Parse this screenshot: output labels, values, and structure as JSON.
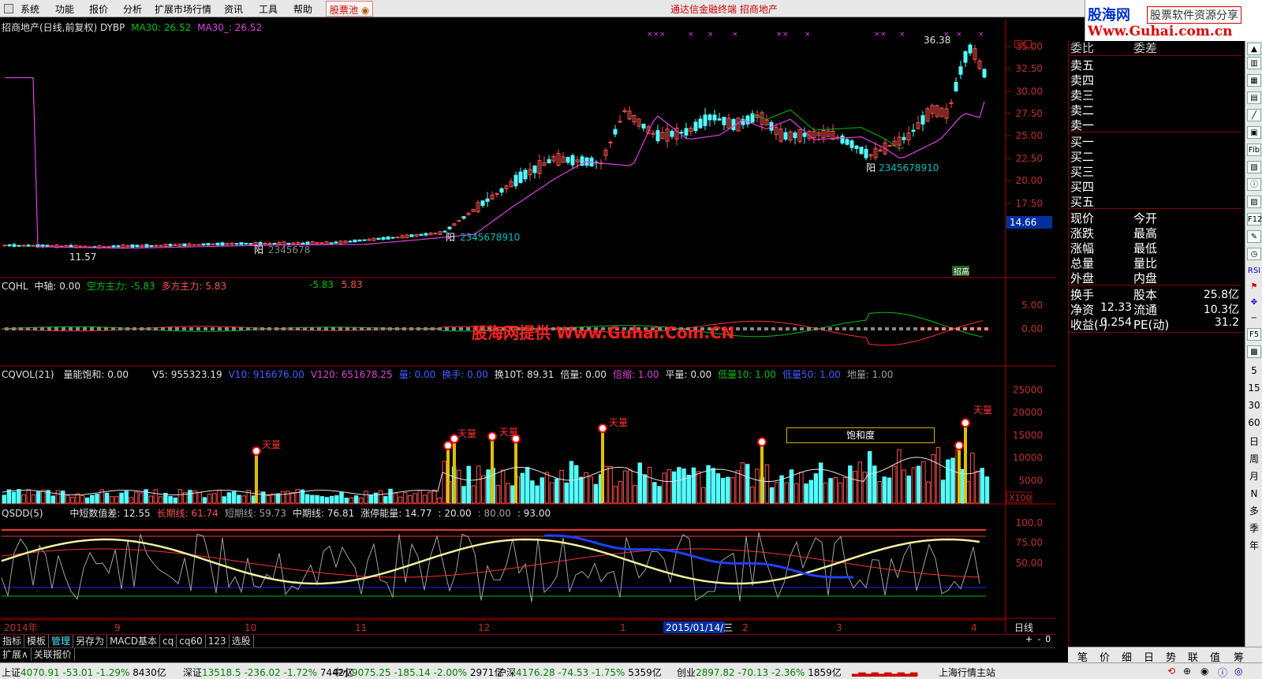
{
  "menu": {
    "items": [
      "系统",
      "功能",
      "报价",
      "分析",
      "扩展市场行情",
      "资讯",
      "工具",
      "帮助"
    ],
    "stock_pool": "股票池",
    "center_title": "通达信金融终端    招商地产"
  },
  "brand": {
    "name": "股海网",
    "slogan": "股票软件资源分享",
    "url": "Www.Guhai.com.cn"
  },
  "chart_header": {
    "title": "招商地产(日线,前复权) DYBP",
    "ma30_label": "MA30: 26.52",
    "ma30b_label": "MA30_: 26.52"
  },
  "price_panel": {
    "y_ticks": [
      "35.00",
      "32.50",
      "30.00",
      "27.50",
      "25.00",
      "22.50",
      "20.00",
      "17.50"
    ],
    "current_price_box": "14.66",
    "high_label": "36.38",
    "low_label": "11.57",
    "yang_label_1": "阳",
    "yang_digits_1": "2345678",
    "yang_label_2": "阳",
    "yang_digits_2": "2345678910",
    "yang_label_3": "阳",
    "yang_digits_3": "2345678910",
    "corner_tag": "招高",
    "colors": {
      "up": "#ff5050",
      "down": "#54ffff",
      "ma": "#e040e0",
      "ma2": "#00c000"
    }
  },
  "cqhl_panel": {
    "name": "CQHL",
    "midaxis": "中轴: 0.00",
    "short": "空方主力: -5.83",
    "long": "多方主力: 5.83",
    "r1": "-5.83",
    "r2": "5.83",
    "y_ticks": [
      "5.00",
      "0.00"
    ],
    "watermark": "股海网提供 Www.Guhai.Com.CN"
  },
  "cqvol_panel": {
    "name": "CQVOL(21)",
    "items": [
      {
        "t": "量能饱和: 0.00",
        "c": "#e0e0e0"
      },
      {
        "t": "V5: 955323.19",
        "c": "#e0e0e0"
      },
      {
        "t": "V10: 916676.00",
        "c": "#4060ff"
      },
      {
        "t": "V120: 651678.25",
        "c": "#e040e0"
      },
      {
        "t": "量: 0.00",
        "c": "#4060ff"
      },
      {
        "t": "换手: 0.00",
        "c": "#4060ff"
      },
      {
        "t": "换10T: 89.31",
        "c": "#e0e0e0"
      },
      {
        "t": "倍量: 0.00",
        "c": "#e0e0e0"
      },
      {
        "t": "倍缩: 1.00",
        "c": "#e040e0"
      },
      {
        "t": "平量: 0.00",
        "c": "#e0e0e0"
      },
      {
        "t": "低量10: 1.00",
        "c": "#00c000"
      },
      {
        "t": "低量50: 1.00",
        "c": "#4060ff"
      },
      {
        "t": "地量: 1.00",
        "c": "#a0a0a0"
      }
    ],
    "y_ticks": [
      "25000",
      "20000",
      "15000",
      "10000",
      "5000"
    ],
    "unit": "X100",
    "tianliang": "天量",
    "saturation_box": "饱和度"
  },
  "qsdd_panel": {
    "name": "QSDD(5)",
    "items": [
      {
        "t": "中短数值差: 12.55",
        "c": "#e0e0e0"
      },
      {
        "t": "长期线: 61.74",
        "c": "#ff5050"
      },
      {
        "t": "短期线: 59.73",
        "c": "#a0a0a0"
      },
      {
        "t": "中期线: 76.81",
        "c": "#e0e0e0"
      },
      {
        "t": "涨停能量: 14.77",
        "c": "#e0e0e0"
      },
      {
        "t": ": 20.00",
        "c": "#e0e0e0"
      },
      {
        "t": ": 80.00",
        "c": "#a0a0a0"
      },
      {
        "t": ": 93.00",
        "c": "#e0e0e0"
      }
    ],
    "y_ticks": [
      "100.0",
      "75.00",
      "50.00"
    ]
  },
  "x_axis": {
    "labels": [
      "2014年",
      "9",
      "10",
      "11",
      "12",
      "1",
      "2015/01/14/三",
      "2",
      "3",
      "4"
    ],
    "period": "日线"
  },
  "bottom_tabs": [
    "指标",
    "模板",
    "管理",
    "另存为",
    "MACD基本",
    "cq",
    "cq60",
    "123",
    "选股"
  ],
  "bottom_tabs2": [
    "扩展∧",
    "关联报价"
  ],
  "zoom": [
    "+",
    "-",
    "0"
  ],
  "order_book": {
    "header_left": "委比",
    "header_right": "委差",
    "sells": [
      "卖五",
      "卖四",
      "卖三",
      "卖二",
      "卖一"
    ],
    "buys": [
      "买一",
      "买二",
      "买三",
      "买四",
      "买五"
    ],
    "quote_left": [
      "现价",
      "涨跌",
      "涨幅",
      "总量",
      "外盘"
    ],
    "quote_right": [
      "今开",
      "最高",
      "最低",
      "量比",
      "内盘"
    ],
    "extra": [
      {
        "l": "换手",
        "lv": "",
        "r": "股本",
        "rv": "25.8亿"
      },
      {
        "l": "净资",
        "lv": "12.33",
        "r": "流通",
        "rv": "10.3亿"
      },
      {
        "l": "收益(-)",
        "lv": "0.254",
        "r": "PE(动)",
        "rv": "31.2"
      }
    ]
  },
  "rp_tabs": [
    "笔",
    "价",
    "细",
    "日",
    "势",
    "联",
    "值",
    "筹"
  ],
  "right_tools": [
    "5",
    "15",
    "30",
    "60",
    "日",
    "周",
    "月",
    "N",
    "多",
    "季",
    "年"
  ],
  "status_bar": [
    {
      "name": "上证",
      "val": "4070.91",
      "chg": "-53.01",
      "pct": "-1.29%",
      "amt": "8430亿"
    },
    {
      "name": "深证",
      "val": "13518.5",
      "chg": "-236.02",
      "pct": "-1.72%",
      "amt": "7442亿"
    },
    {
      "name": "中小",
      "val": "9075.25",
      "chg": "-185.14",
      "pct": "-2.00%",
      "amt": "2971亿"
    },
    {
      "name": "沪深",
      "val": "4176.28",
      "chg": "-74.53",
      "pct": "-1.75%",
      "amt": "5359亿"
    },
    {
      "name": "创业",
      "val": "2897.82",
      "chg": "-70.13",
      "pct": "-2.36%",
      "amt": "1859亿"
    }
  ],
  "status_station": "上海行情主站"
}
